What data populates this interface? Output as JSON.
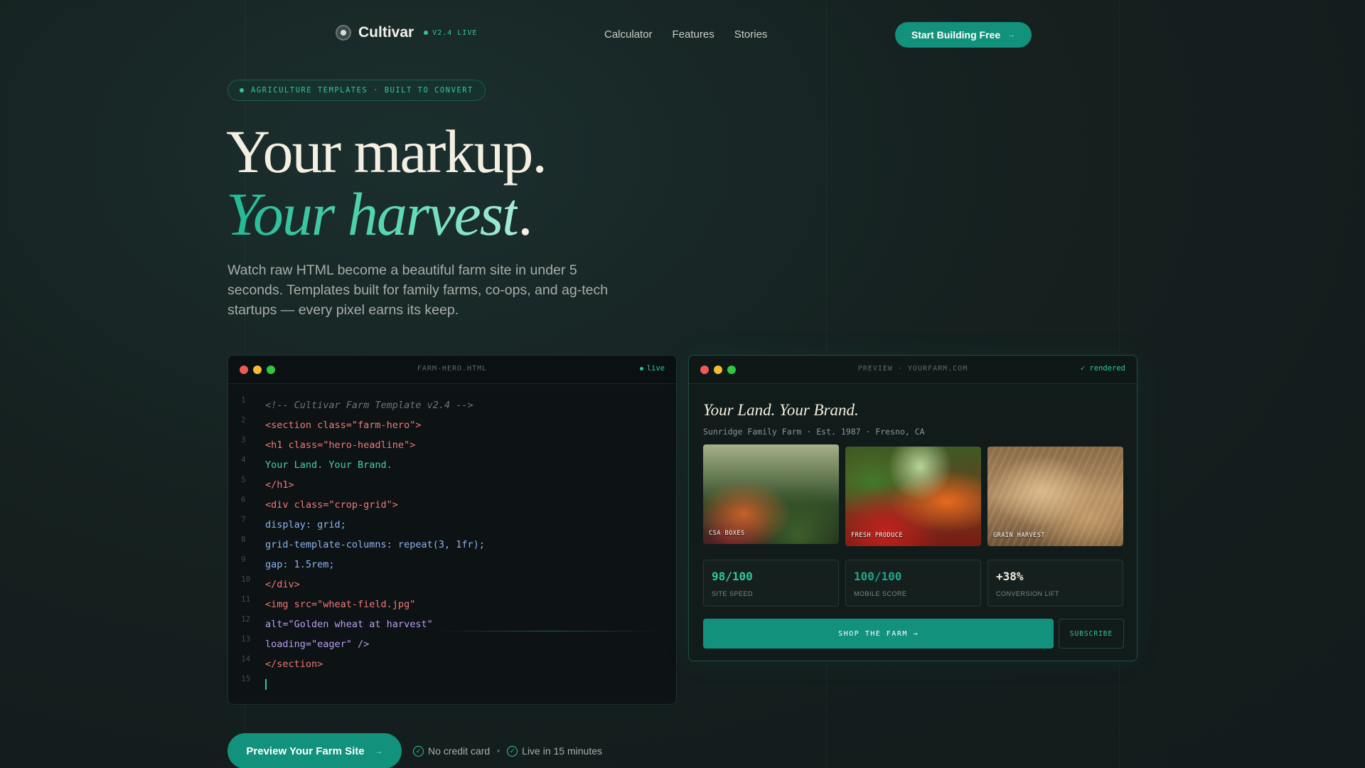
{
  "nav": {
    "brand": "Cultivar",
    "version": "V2.4 LIVE",
    "links": [
      "Calculator",
      "Features",
      "Stories"
    ],
    "cta_label": "Start Building Free",
    "cta_arrow": "→"
  },
  "hero": {
    "badge": "AGRICULTURE TEMPLATES · BUILT TO CONVERT",
    "headline_1": "Your markup.",
    "headline_2": "Your harvest",
    "headline_2_period": ".",
    "subtext": "Watch raw HTML become a beautiful farm site in under 5 seconds. Templates built for family farms, co-ops, and ag-tech startups — every pixel earns its keep."
  },
  "code_panel": {
    "title": "FARM-HERO.HTML",
    "status": "live",
    "lines": [
      {
        "n": "1",
        "text": "<!-- Cultivar Farm Template v2.4 -->",
        "kind": "comment"
      },
      {
        "n": "2",
        "text": "<section class=\"farm-hero\">",
        "kind": "tag"
      },
      {
        "n": "3",
        "text": "<h1 class=\"hero-headline\">",
        "kind": "tag"
      },
      {
        "n": "4",
        "text": "Your Land. Your Brand.",
        "kind": "text"
      },
      {
        "n": "5",
        "text": "</h1>",
        "kind": "tag"
      },
      {
        "n": "6",
        "text": "<div class=\"crop-grid\">",
        "kind": "tag"
      },
      {
        "n": "7",
        "text": "display: grid;",
        "kind": "css"
      },
      {
        "n": "8",
        "text": "grid-template-columns: repeat(3, 1fr);",
        "kind": "css"
      },
      {
        "n": "9",
        "text": "gap: 1.5rem;",
        "kind": "css"
      },
      {
        "n": "10",
        "text": "</div>",
        "kind": "tag"
      },
      {
        "n": "11",
        "text": "<img src=\"wheat-field.jpg\"",
        "kind": "tag"
      },
      {
        "n": "12",
        "text": "alt=\"Golden wheat at harvest\"",
        "kind": "attr"
      },
      {
        "n": "13",
        "text": "loading=\"eager\" />",
        "kind": "attr"
      },
      {
        "n": "14",
        "text": "</section>",
        "kind": "tag"
      },
      {
        "n": "15",
        "text": "",
        "kind": "cursor"
      }
    ]
  },
  "preview_panel": {
    "title": "PREVIEW · YOURFARM.COM",
    "status": "✓ rendered",
    "site_title": "Your Land. Your Brand.",
    "site_sub": "Sunridge Family Farm · Est. 1987 · Fresno, CA",
    "photos": [
      "CSA BOXES",
      "FRESH PRODUCE",
      "GRAIN HARVEST"
    ],
    "stats": [
      {
        "value": "98/100",
        "label": "SITE SPEED"
      },
      {
        "value": "100/100",
        "label": "MOBILE SCORE"
      },
      {
        "value": "+38%",
        "label": "CONVERSION LIFT"
      }
    ],
    "shop_label": "SHOP THE FARM →",
    "subscribe_label": "SUBSCRIBE"
  },
  "bottom": {
    "cta_label": "Preview Your Farm Site",
    "cta_arrow": "→",
    "check_1": "No credit card",
    "check_2": "Live in 15 minutes"
  },
  "colors": {
    "accent": "#12917c",
    "accent_text": "#2fc79e",
    "background": "#15201f"
  }
}
